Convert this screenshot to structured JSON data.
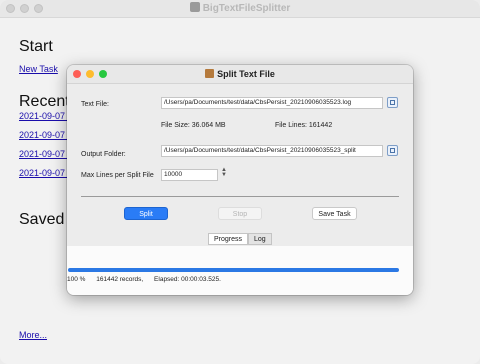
{
  "main_window": {
    "title": "BigTextFileSplitter",
    "start_heading": "Start",
    "new_task_link": "New Task",
    "recent_heading": "Recent",
    "recent_items": [
      "2021-09-07 1",
      "2021-09-07 1",
      "2021-09-07 1",
      "2021-09-07 1"
    ],
    "saved_heading": "Saved T",
    "more_link": "More..."
  },
  "dialog": {
    "title": "Split Text File",
    "text_file_label": "Text File:",
    "text_file_value": "/Users/pa/Documents/test/data/CbsPersist_20210906035523.log",
    "file_size_text": "File Size: 36.064 MB",
    "file_lines_text": "File Lines: 161442",
    "output_folder_label": "Output Folder:",
    "output_folder_value": "/Users/pa/Documents/test/data/CbsPersist_20210906035523_split",
    "max_lines_label": "Max Lines per Split File",
    "max_lines_value": "10000",
    "split_button": "Split",
    "stop_button": "Stop",
    "save_task_button": "Save Task",
    "tabs": [
      {
        "label": "Progress",
        "active": true
      },
      {
        "label": "Log",
        "active": false
      }
    ],
    "progress_fraction": 1.0,
    "status": {
      "percent": "100 %",
      "records": "161442 records,",
      "elapsed": "Elapsed: 00:00:03.525."
    }
  },
  "colors": {
    "accent": "#2a7cf6",
    "progress": "#2b78e4",
    "link": "#1a0dab"
  }
}
